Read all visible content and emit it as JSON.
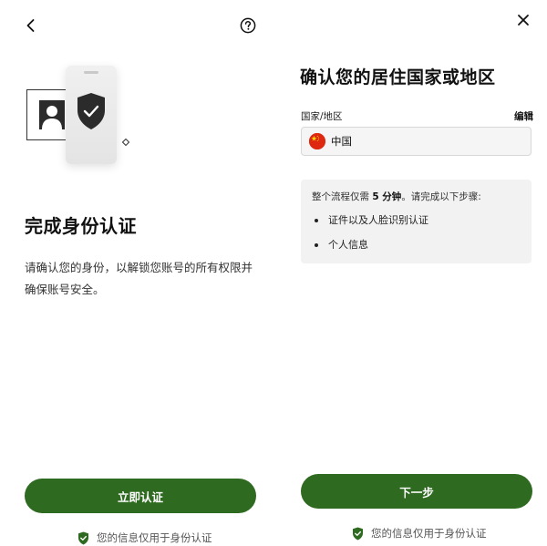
{
  "left": {
    "title": "完成身份认证",
    "description": "请确认您的身份，以解锁您账号的所有权限并确保账号安全。",
    "primary_button": "立即认证",
    "privacy_note": "您的信息仅用于身份认证",
    "icons": {
      "back": "chevron-left-icon",
      "help": "question-circle-icon",
      "shield": "shield-check-icon"
    }
  },
  "right": {
    "title": "确认您的居住国家或地区",
    "field_label": "国家/地区",
    "edit_label": "编辑",
    "country": {
      "name": "中国",
      "flag_icon": "china-flag-icon"
    },
    "info": {
      "intro_prefix": "整个流程仅需 ",
      "intro_duration": "5 分钟",
      "intro_suffix": "。请完成以下步骤:",
      "steps": [
        "证件以及人脸识别认证",
        "个人信息"
      ]
    },
    "primary_button": "下一步",
    "privacy_note": "您的信息仅用于身份认证",
    "icons": {
      "close": "close-icon"
    }
  },
  "colors": {
    "primary": "#2e6a1f",
    "info_bg": "#f2f2f2",
    "field_bg": "#f5f5f5"
  }
}
